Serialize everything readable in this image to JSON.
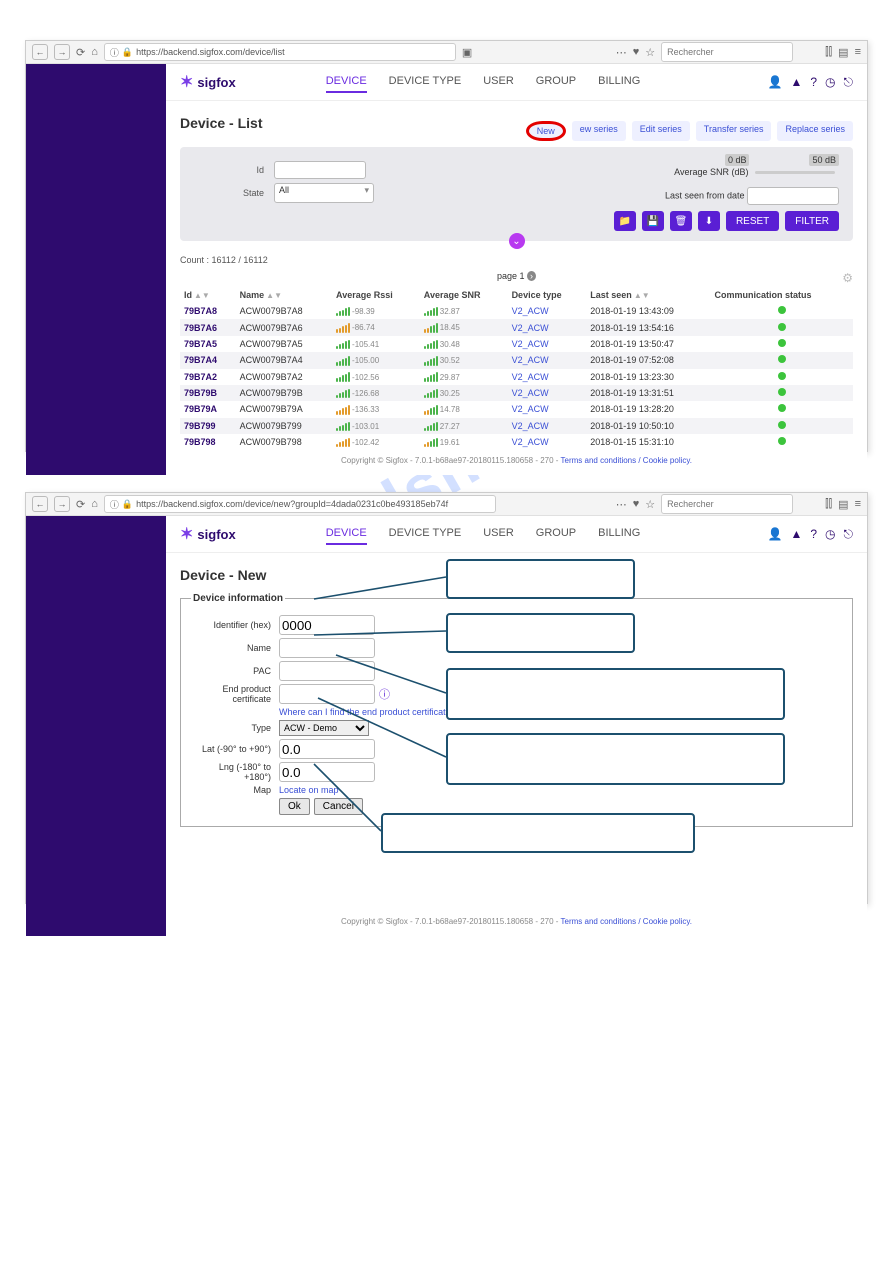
{
  "watermark": "manualshive.com",
  "browser1": {
    "url": "https://backend.sigfox.com/device/list",
    "search_placeholder": "Rechercher",
    "nav": [
      "DEVICE",
      "DEVICE TYPE",
      "USER",
      "GROUP",
      "BILLING"
    ],
    "title": "Device - List",
    "actions": [
      "New",
      "ew series",
      "Edit series",
      "Transfer series",
      "Replace series"
    ],
    "filter": {
      "id_label": "Id",
      "state_label": "State",
      "state_value": "All",
      "snr_label": "Average SNR (dB)",
      "snr_min": "0 dB",
      "snr_max": "50 dB",
      "lastseen_label": "Last seen from date"
    },
    "buttons": {
      "reset": "RESET",
      "filter": "FILTER"
    },
    "count": "Count : 16112 / 16112",
    "pager": "page 1",
    "headers": [
      "Id",
      "Name",
      "Average Rssi",
      "Average SNR",
      "Device type",
      "Last seen",
      "Communication status"
    ],
    "rows": [
      {
        "id": "79B7A8",
        "name": "ACW0079B7A8",
        "rssi": "-98.39",
        "snr": "32.87",
        "dtype": "V2_ACW",
        "last": "2018-01-19 13:43:09",
        "sig1": "green",
        "sig2": "green"
      },
      {
        "id": "79B7A6",
        "name": "ACW0079B7A6",
        "rssi": "-86.74",
        "snr": "18.45",
        "dtype": "V2_ACW",
        "last": "2018-01-19 13:54:16",
        "sig1": "orange",
        "sig2": "mix"
      },
      {
        "id": "79B7A5",
        "name": "ACW0079B7A5",
        "rssi": "-105.41",
        "snr": "30.48",
        "dtype": "V2_ACW",
        "last": "2018-01-19 13:50:47",
        "sig1": "green",
        "sig2": "green"
      },
      {
        "id": "79B7A4",
        "name": "ACW0079B7A4",
        "rssi": "-105.00",
        "snr": "30.52",
        "dtype": "V2_ACW",
        "last": "2018-01-19 07:52:08",
        "sig1": "green",
        "sig2": "green"
      },
      {
        "id": "79B7A2",
        "name": "ACW0079B7A2",
        "rssi": "-102.56",
        "snr": "29.87",
        "dtype": "V2_ACW",
        "last": "2018-01-19 13:23:30",
        "sig1": "green",
        "sig2": "green"
      },
      {
        "id": "79B79B",
        "name": "ACW0079B79B",
        "rssi": "-126.68",
        "snr": "30.25",
        "dtype": "V2_ACW",
        "last": "2018-01-19 13:31:51",
        "sig1": "green",
        "sig2": "green"
      },
      {
        "id": "79B79A",
        "name": "ACW0079B79A",
        "rssi": "-136.33",
        "snr": "14.78",
        "dtype": "V2_ACW",
        "last": "2018-01-19 13:28:20",
        "sig1": "orange",
        "sig2": "mix"
      },
      {
        "id": "79B799",
        "name": "ACW0079B799",
        "rssi": "-103.01",
        "snr": "27.27",
        "dtype": "V2_ACW",
        "last": "2018-01-19 10:50:10",
        "sig1": "green",
        "sig2": "green"
      },
      {
        "id": "79B798",
        "name": "ACW0079B798",
        "rssi": "-102.42",
        "snr": "19.61",
        "dtype": "V2_ACW",
        "last": "2018-01-15 15:31:10",
        "sig1": "orange",
        "sig2": "mix"
      }
    ],
    "footer": "Copyright © Sigfox - 7.0.1-b68ae97-20180115.180658 - 270 - ",
    "footer_links": "Terms and conditions / Cookie policy."
  },
  "browser2": {
    "url": "https://backend.sigfox.com/device/new?groupId=4dada0231c0be493185eb74f",
    "search_placeholder": "Rechercher",
    "title": "Device - New",
    "legend": "Device information",
    "form": {
      "identifier_label": "Identifier (hex)",
      "identifier_value": "0000",
      "name_label": "Name",
      "pac_label": "PAC",
      "cert_label": "End product certificate",
      "cert_link": "Where can I find the end product certificate?",
      "type_label": "Type",
      "type_value": "ACW - Demo",
      "lat_label": "Lat (-90° to +90°)",
      "lat_value": "0.0",
      "lng_label": "Lng (-180° to +180°)",
      "lng_value": "0.0",
      "map_label": "Map",
      "map_link": "Locate on map",
      "ok": "Ok",
      "cancel": "Cancel"
    },
    "footer": "Copyright © Sigfox - 7.0.1-b68ae97-20180115.180658 - 270 - ",
    "footer_links": "Terms and conditions / Cookie policy."
  }
}
